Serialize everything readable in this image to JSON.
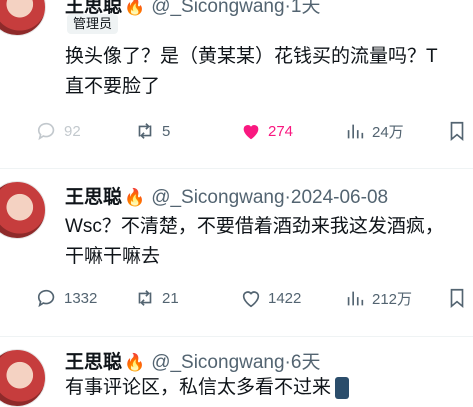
{
  "posts": [
    {
      "name": "王思聪",
      "handle": "@_Sicongwang·1天",
      "badge": "管理员",
      "lines": [
        "换头像了？是（黄某某）花钱买的流量吗？T",
        "直不要脸了"
      ],
      "replies": "92",
      "reposts": "5",
      "likes": "274",
      "views": "24万",
      "liked": true
    },
    {
      "name": "王思聪",
      "handle": "@_Sicongwang·2024-06-08",
      "lines": [
        "Wsc？不清楚，不要借着酒劲来我这发酒疯，",
        "干嘛干嘛去"
      ],
      "replies": "1332",
      "reposts": "21",
      "likes": "1422",
      "views": "212万",
      "liked": false
    },
    {
      "name": "王思聪",
      "handle": "@_Sicongwang·6天",
      "lines": [
        "有事评论区，私信太多看不过来"
      ]
    }
  ],
  "icons": [
    "fire-emoji-icon",
    "reply-icon",
    "repost-icon",
    "like-icon",
    "views-icon",
    "bookmark-icon",
    "phone-emoji-icon"
  ],
  "colors": {
    "like_active": "#f91880",
    "muted": "#536471",
    "badge_bg": "#eff3f4"
  }
}
